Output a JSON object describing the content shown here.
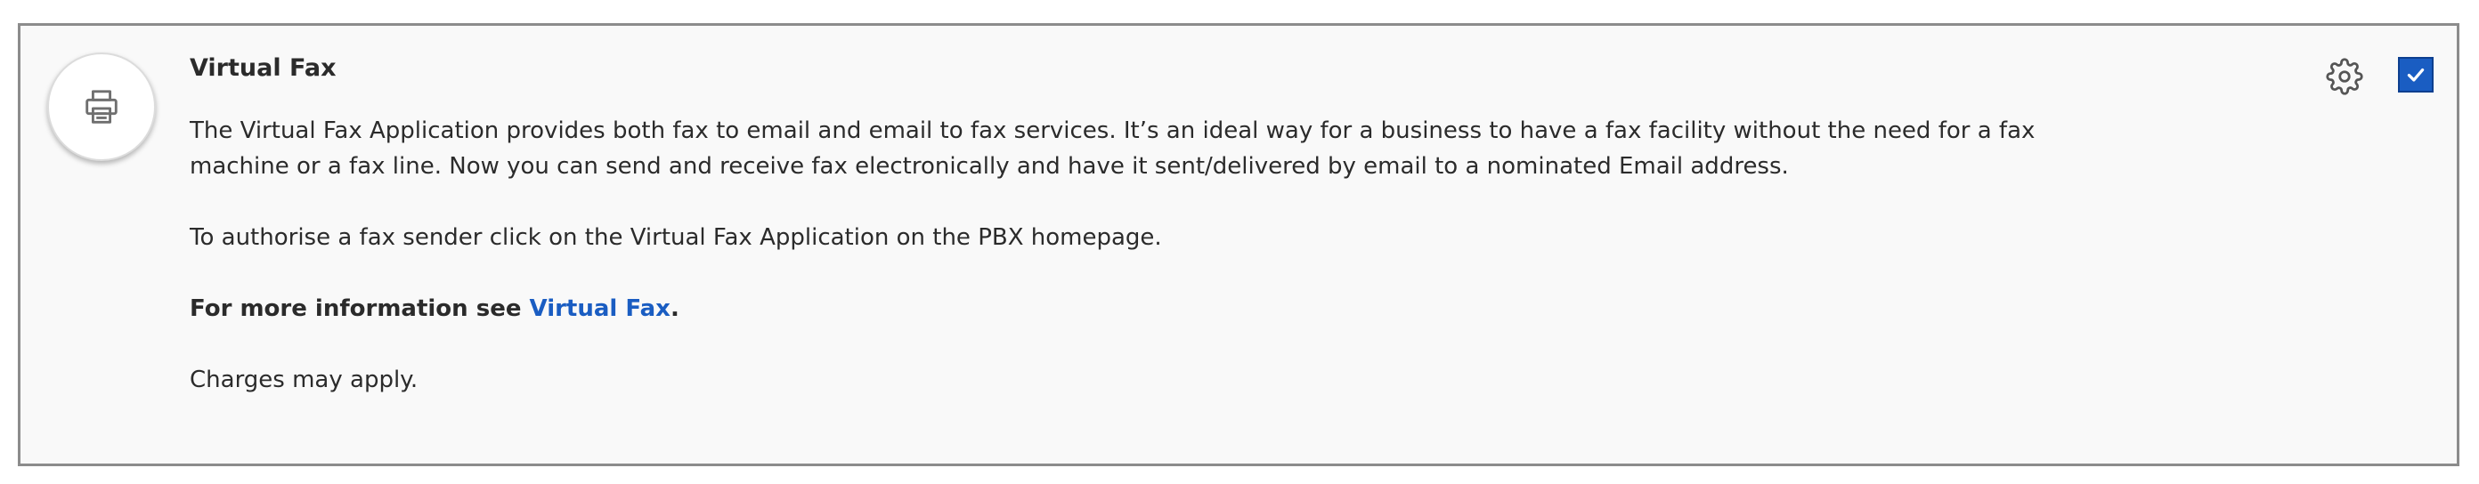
{
  "item": {
    "icon": "printer-icon",
    "title": "Virtual Fax",
    "description": "The Virtual Fax Application provides both fax to email and email to fax services. It’s an ideal way for a business to have a fax facility without the need for a fax machine or a fax line. Now you can send and receive fax electronically and have it sent/delivered by email to a nominated Email address.",
    "authorise_text": "To authorise a fax sender click on the Virtual Fax Application on the PBX homepage.",
    "more_info_prefix": "For more information see ",
    "more_info_link": "Virtual Fax",
    "more_info_suffix": ".",
    "charges_text": "Charges may apply.",
    "settings_icon": "gear-icon",
    "checkbox_checked": true
  },
  "colors": {
    "accent": "#1a5dc2",
    "border": "#8c8c8c",
    "background": "#f9f9f9",
    "text": "#2b2b2b"
  }
}
